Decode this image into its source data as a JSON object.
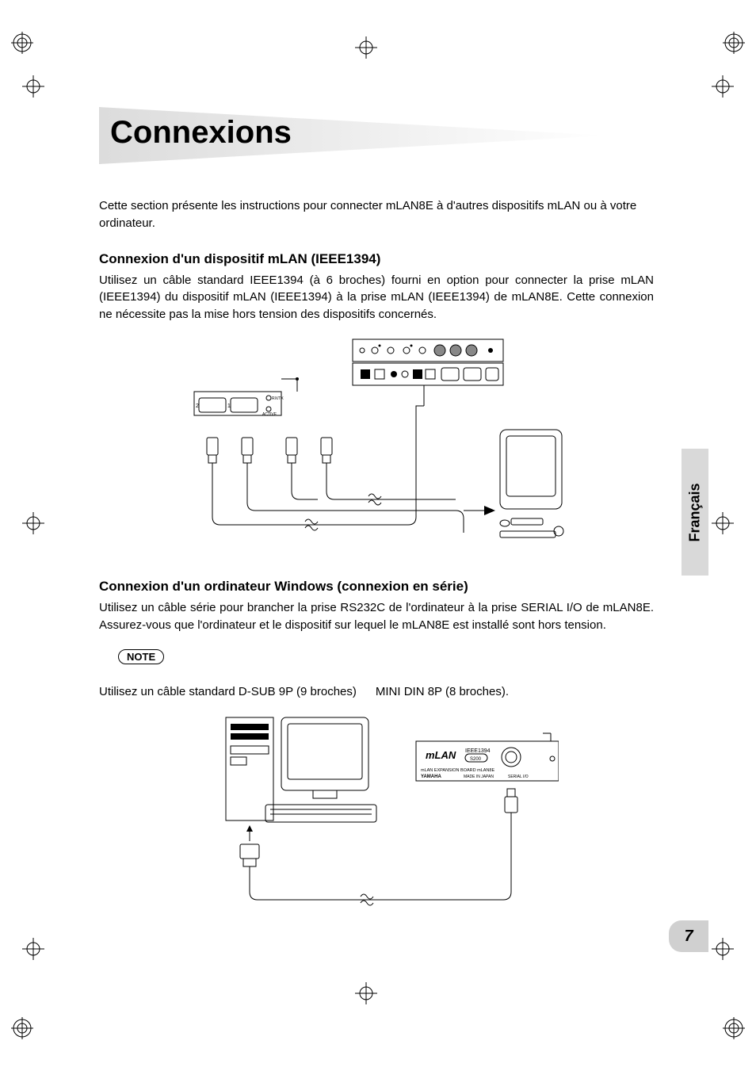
{
  "title": "Connexions",
  "intro": "Cette section présente les instructions pour connecter mLAN8E à d'autres dispositifs mLAN ou à votre ordinateur.",
  "section1": {
    "heading": "Connexion d'un dispositif mLAN (IEEE1394)",
    "body": "Utilisez un câble standard IEEE1394 (à 6 broches) fourni en option pour connecter la prise mLAN (IEEE1394) du dispositif mLAN (IEEE1394) à la prise mLAN (IEEE1394) de mLAN8E. Cette connexion ne nécessite pas la mise hors tension des dispositifs concernés."
  },
  "section2": {
    "heading": "Connexion d'un ordinateur Windows (connexion en série)",
    "body": "Utilisez un câble série pour brancher la prise RS232C de l'ordinateur à la prise SERIAL I/O de mLAN8E. Assurez-vous que l'ordinateur et le dispositif sur lequel le mLAN8E est installé sont hors tension."
  },
  "note_label": "NOTE",
  "cable_left": "Utilisez un câble standard D-SUB 9P (9 broches)",
  "cable_right": "MINI DIN 8P (8 broches).",
  "diagram1_labels": {
    "port2": "2",
    "port1": "1",
    "rx": "RX/TX",
    "active": "ACTIVE"
  },
  "diagram2_labels": {
    "brand": "mLAN",
    "ieee": "IEEE1394",
    "model": "S200",
    "board": "mLAN EXPANSION BOARD mLAN8E",
    "maker": "YAMAHA",
    "made": "MADE IN JAPAN",
    "ser": "SERIAL I/O"
  },
  "language_tab": "Français",
  "page_number": "7"
}
